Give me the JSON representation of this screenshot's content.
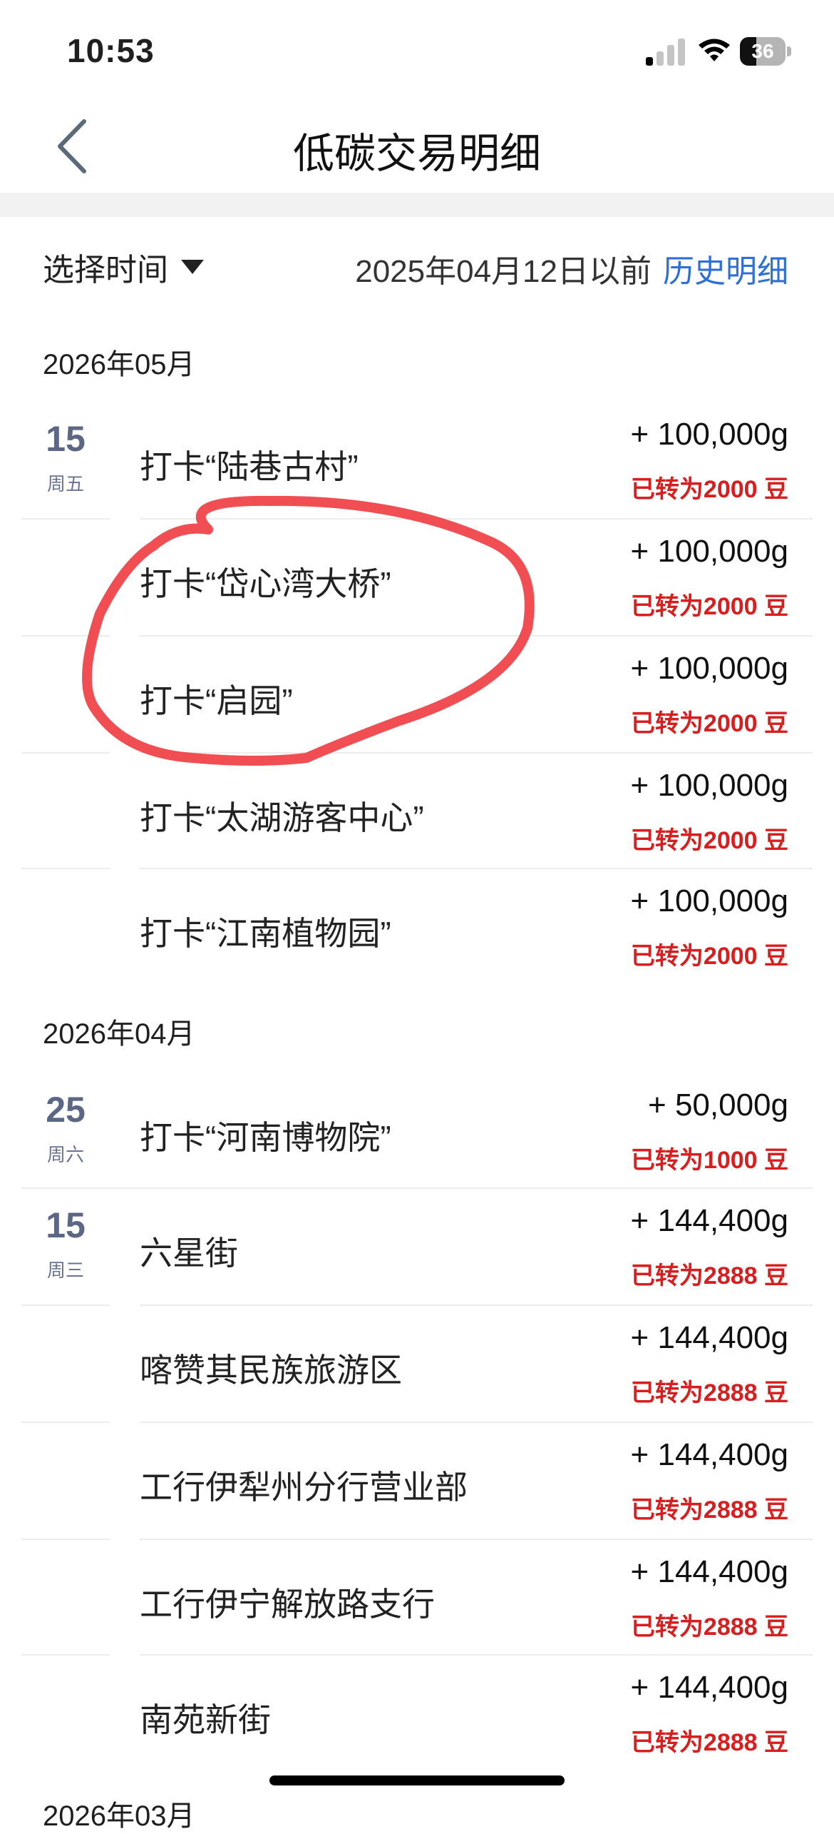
{
  "status_bar": {
    "time": "10:53",
    "battery": "36"
  },
  "nav": {
    "title": "低碳交易明细"
  },
  "filter": {
    "select_time": "选择时间",
    "date_range": "2025年04月12日以前",
    "history_link": "历史明细"
  },
  "groups": [
    {
      "month": "2026年05月",
      "rows": [
        {
          "day": "15",
          "weekday": "周五",
          "title": "打卡“陆巷古村”",
          "amount": "+ 100,000g",
          "note": "已转为2000 豆"
        },
        {
          "day": "",
          "weekday": "",
          "title": "打卡“岱心湾大桥”",
          "amount": "+ 100,000g",
          "note": "已转为2000 豆"
        },
        {
          "day": "",
          "weekday": "",
          "title": "打卡“启园”",
          "amount": "+ 100,000g",
          "note": "已转为2000 豆"
        },
        {
          "day": "",
          "weekday": "",
          "title": "打卡“太湖游客中心”",
          "amount": "+ 100,000g",
          "note": "已转为2000 豆"
        },
        {
          "day": "",
          "weekday": "",
          "title": "打卡“江南植物园”",
          "amount": "+ 100,000g",
          "note": "已转为2000 豆"
        }
      ]
    },
    {
      "month": "2026年04月",
      "rows": [
        {
          "day": "25",
          "weekday": "周六",
          "title": "打卡“河南博物院”",
          "amount": "+ 50,000g",
          "note": "已转为1000 豆"
        },
        {
          "day": "15",
          "weekday": "周三",
          "title": "六星街",
          "amount": "+ 144,400g",
          "note": "已转为2888 豆"
        },
        {
          "day": "",
          "weekday": "",
          "title": "喀赞其民族旅游区",
          "amount": "+ 144,400g",
          "note": "已转为2888 豆"
        },
        {
          "day": "",
          "weekday": "",
          "title": "工行伊犁州分行营业部",
          "amount": "+ 144,400g",
          "note": "已转为2888 豆"
        },
        {
          "day": "",
          "weekday": "",
          "title": "工行伊宁解放路支行",
          "amount": "+ 144,400g",
          "note": "已转为2888 豆"
        },
        {
          "day": "",
          "weekday": "",
          "title": "南苑新街",
          "amount": "+ 144,400g",
          "note": "已转为2888 豆"
        }
      ]
    }
  ],
  "cut_month": "2026年03月",
  "colors": {
    "link": "#2f6fd8",
    "note_red": "#d81e1e",
    "day_blue_gray": "#5c6786",
    "annotation_red": "#f0444a"
  }
}
